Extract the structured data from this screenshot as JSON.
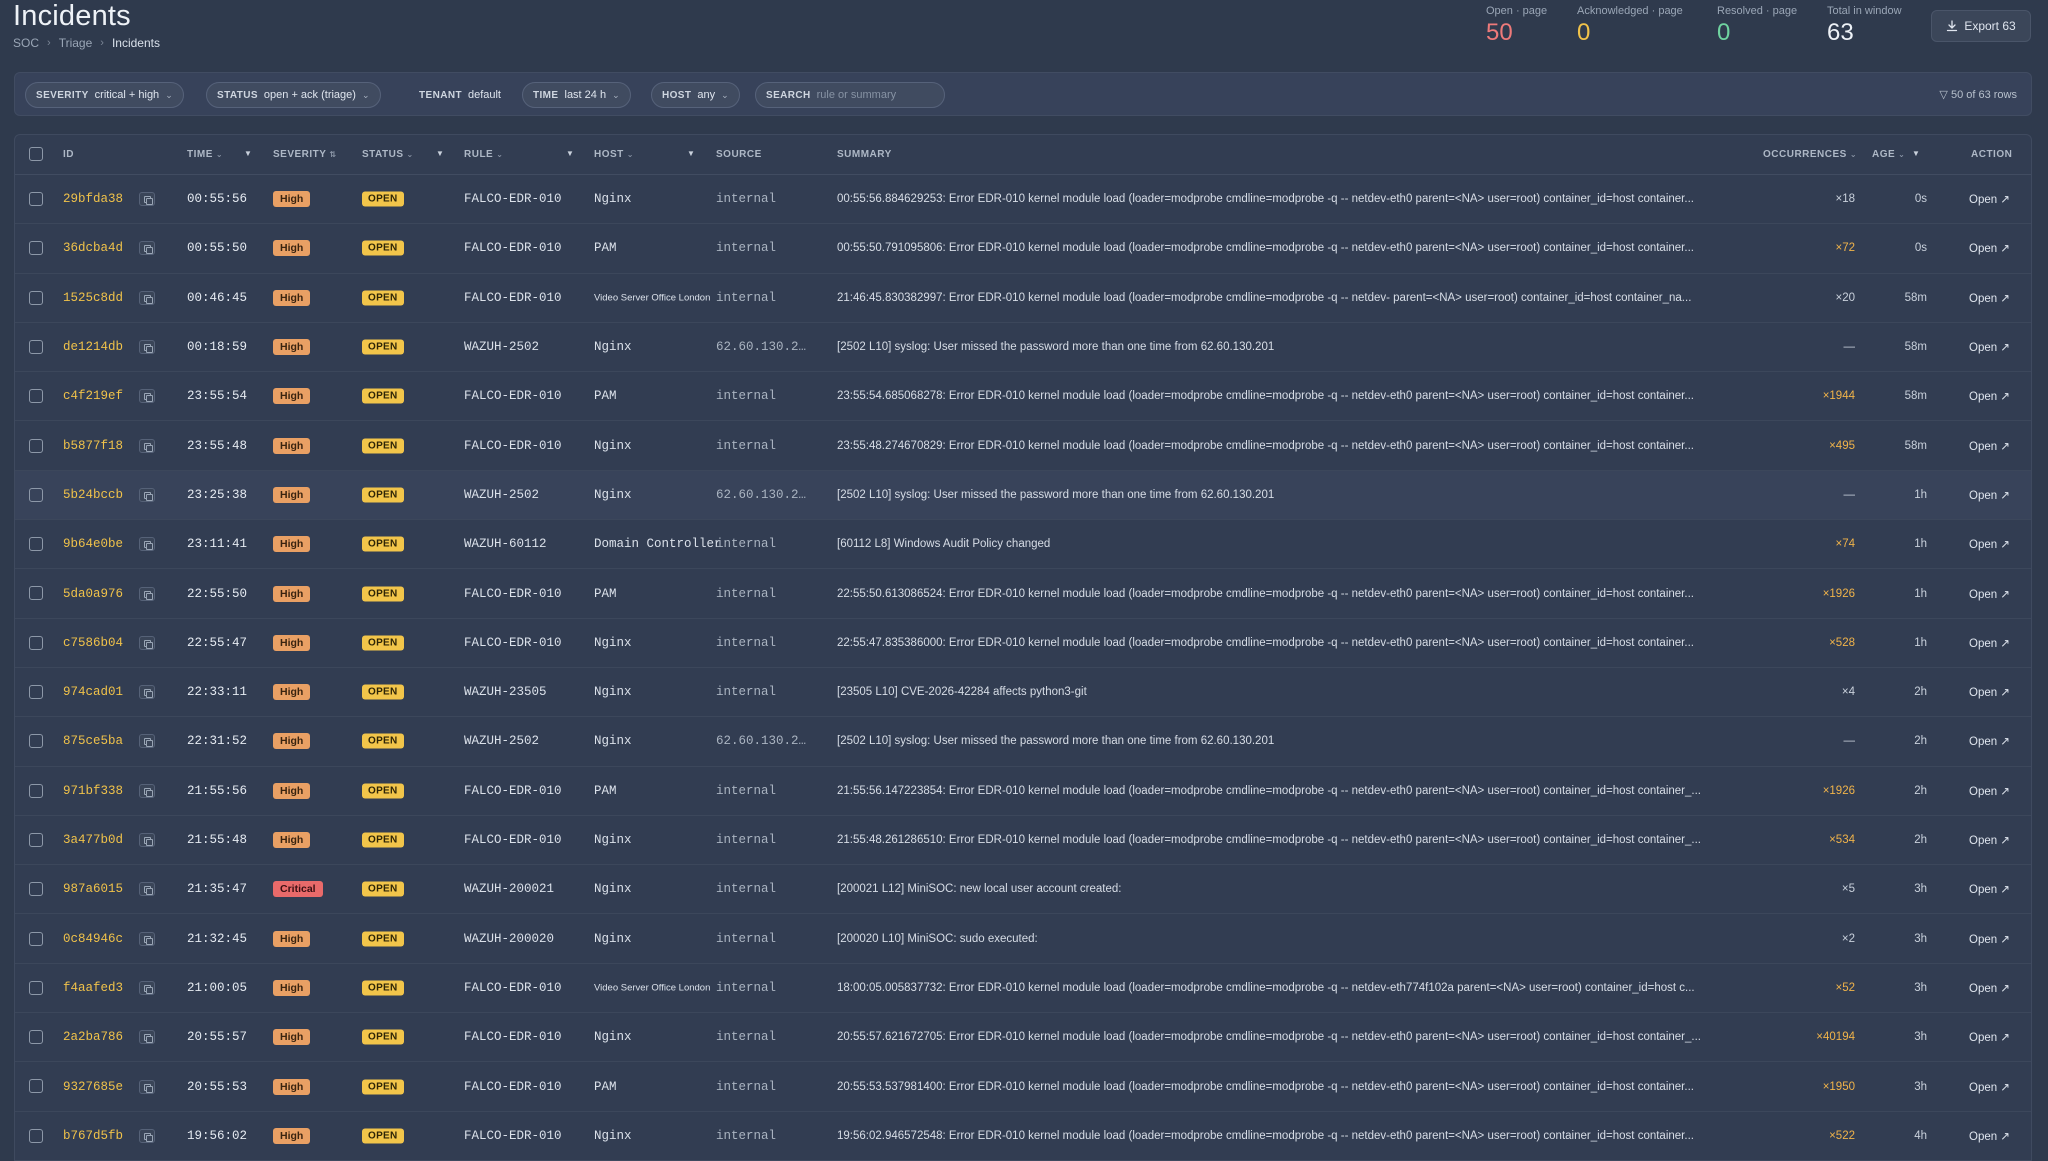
{
  "header": {
    "title": "Incidents",
    "breadcrumb": [
      "SOC",
      "Triage",
      "Incidents"
    ],
    "stats": [
      {
        "label": "Open · page",
        "value": "50",
        "color": "#ee7a7a"
      },
      {
        "label": "Acknowledged · page",
        "value": "0",
        "color": "#f0c24a"
      },
      {
        "label": "Resolved · page",
        "value": "0",
        "color": "#6fd3a0"
      },
      {
        "label": "Total in window",
        "value": "63",
        "color": "#eef2f7"
      }
    ],
    "export_label": "Export 63"
  },
  "filters": {
    "severity": {
      "key": "SEVERITY",
      "value": "critical + high"
    },
    "status": {
      "key": "STATUS",
      "value": "open + ack (triage)"
    },
    "tenant": {
      "key": "TENANT",
      "value": "default"
    },
    "time": {
      "key": "TIME",
      "value": "last 24 h"
    },
    "host": {
      "key": "HOST",
      "value": "any"
    },
    "search": {
      "key": "SEARCH",
      "placeholder": "rule or summary"
    },
    "row_count": "50 of 63 rows"
  },
  "table": {
    "columns": {
      "id": "ID",
      "time": "TIME",
      "severity": "SEVERITY",
      "status": "STATUS",
      "rule": "RULE",
      "host": "HOST",
      "source": "SOURCE",
      "summary": "SUMMARY",
      "occurrences": "OCCURRENCES",
      "age": "AGE",
      "action": "ACTION"
    },
    "action_label": "Open ↗",
    "rows": [
      {
        "id": "29bfda38",
        "time": "00:55:56",
        "severity": "High",
        "status": "OPEN",
        "rule": "FALCO-EDR-010",
        "host": "Nginx",
        "source": "internal",
        "summary": "00:55:56.884629253: Error EDR-010 kernel module load (loader=modprobe cmdline=modprobe -q -- netdev-eth0 parent=<NA> user=root) container_id=host container...",
        "occurrences": "×18",
        "age": "0s"
      },
      {
        "id": "36dcba4d",
        "time": "00:55:50",
        "severity": "High",
        "status": "OPEN",
        "rule": "FALCO-EDR-010",
        "host": "PAM",
        "source": "internal",
        "summary": "00:55:50.791095806: Error EDR-010 kernel module load (loader=modprobe cmdline=modprobe -q -- netdev-eth0 parent=<NA> user=root) container_id=host container...",
        "occurrences": "×72",
        "age": "0s"
      },
      {
        "id": "1525c8dd",
        "time": "00:46:45",
        "severity": "High",
        "status": "OPEN",
        "rule": "FALCO-EDR-010",
        "host": "Video Server Office London",
        "source": "internal",
        "summary": "21:46:45.830382997: Error EDR-010 kernel module load (loader=modprobe cmdline=modprobe -q -- netdev- parent=<NA> user=root) container_id=host container_na...",
        "occurrences": "×20",
        "age": "58m"
      },
      {
        "id": "de1214db",
        "time": "00:18:59",
        "severity": "High",
        "status": "OPEN",
        "rule": "WAZUH-2502",
        "host": "Nginx",
        "source": "62.60.130.2…",
        "summary": "[2502 L10] syslog: User missed the password more than one time from 62.60.130.201",
        "occurrences": "—",
        "age": "58m"
      },
      {
        "id": "c4f219ef",
        "time": "23:55:54",
        "severity": "High",
        "status": "OPEN",
        "rule": "FALCO-EDR-010",
        "host": "PAM",
        "source": "internal",
        "summary": "23:55:54.685068278: Error EDR-010 kernel module load (loader=modprobe cmdline=modprobe -q -- netdev-eth0 parent=<NA> user=root) container_id=host container...",
        "occurrences": "×1944",
        "age": "58m"
      },
      {
        "id": "b5877f18",
        "time": "23:55:48",
        "severity": "High",
        "status": "OPEN",
        "rule": "FALCO-EDR-010",
        "host": "Nginx",
        "source": "internal",
        "summary": "23:55:48.274670829: Error EDR-010 kernel module load (loader=modprobe cmdline=modprobe -q -- netdev-eth0 parent=<NA> user=root) container_id=host container...",
        "occurrences": "×495",
        "age": "58m"
      },
      {
        "id": "5b24bccb",
        "time": "23:25:38",
        "severity": "High",
        "status": "OPEN",
        "rule": "WAZUH-2502",
        "host": "Nginx",
        "source": "62.60.130.2…",
        "summary": "[2502 L10] syslog: User missed the password more than one time from 62.60.130.201",
        "occurrences": "—",
        "age": "1h"
      },
      {
        "id": "9b64e0be",
        "time": "23:11:41",
        "severity": "High",
        "status": "OPEN",
        "rule": "WAZUH-60112",
        "host": "Domain Controller",
        "source": "internal",
        "summary": "[60112 L8] Windows Audit Policy changed",
        "occurrences": "×74",
        "age": "1h"
      },
      {
        "id": "5da0a976",
        "time": "22:55:50",
        "severity": "High",
        "status": "OPEN",
        "rule": "FALCO-EDR-010",
        "host": "PAM",
        "source": "internal",
        "summary": "22:55:50.613086524: Error EDR-010 kernel module load (loader=modprobe cmdline=modprobe -q -- netdev-eth0 parent=<NA> user=root) container_id=host container...",
        "occurrences": "×1926",
        "age": "1h"
      },
      {
        "id": "c7586b04",
        "time": "22:55:47",
        "severity": "High",
        "status": "OPEN",
        "rule": "FALCO-EDR-010",
        "host": "Nginx",
        "source": "internal",
        "summary": "22:55:47.835386000: Error EDR-010 kernel module load (loader=modprobe cmdline=modprobe -q -- netdev-eth0 parent=<NA> user=root) container_id=host container...",
        "occurrences": "×528",
        "age": "1h"
      },
      {
        "id": "974cad01",
        "time": "22:33:11",
        "severity": "High",
        "status": "OPEN",
        "rule": "WAZUH-23505",
        "host": "Nginx",
        "source": "internal",
        "summary": "[23505 L10] CVE-2026-42284 affects python3-git",
        "occurrences": "×4",
        "age": "2h"
      },
      {
        "id": "875ce5ba",
        "time": "22:31:52",
        "severity": "High",
        "status": "OPEN",
        "rule": "WAZUH-2502",
        "host": "Nginx",
        "source": "62.60.130.2…",
        "summary": "[2502 L10] syslog: User missed the password more than one time from 62.60.130.201",
        "occurrences": "—",
        "age": "2h"
      },
      {
        "id": "971bf338",
        "time": "21:55:56",
        "severity": "High",
        "status": "OPEN",
        "rule": "FALCO-EDR-010",
        "host": "PAM",
        "source": "internal",
        "summary": "21:55:56.147223854: Error EDR-010 kernel module load (loader=modprobe cmdline=modprobe -q -- netdev-eth0 parent=<NA> user=root) container_id=host container_...",
        "occurrences": "×1926",
        "age": "2h"
      },
      {
        "id": "3a477b0d",
        "time": "21:55:48",
        "severity": "High",
        "status": "OPEN",
        "rule": "FALCO-EDR-010",
        "host": "Nginx",
        "source": "internal",
        "summary": "21:55:48.261286510: Error EDR-010 kernel module load (loader=modprobe cmdline=modprobe -q -- netdev-eth0 parent=<NA> user=root) container_id=host container_...",
        "occurrences": "×534",
        "age": "2h"
      },
      {
        "id": "987a6015",
        "time": "21:35:47",
        "severity": "Critical",
        "status": "OPEN",
        "rule": "WAZUH-200021",
        "host": "Nginx",
        "source": "internal",
        "summary": "[200021 L12] MiniSOC: new local user account created:",
        "occurrences": "×5",
        "age": "3h"
      },
      {
        "id": "0c84946c",
        "time": "21:32:45",
        "severity": "High",
        "status": "OPEN",
        "rule": "WAZUH-200020",
        "host": "Nginx",
        "source": "internal",
        "summary": "[200020 L10] MiniSOC: sudo executed:",
        "occurrences": "×2",
        "age": "3h"
      },
      {
        "id": "f4aafed3",
        "time": "21:00:05",
        "severity": "High",
        "status": "OPEN",
        "rule": "FALCO-EDR-010",
        "host": "Video Server Office London",
        "source": "internal",
        "summary": "18:00:05.005837732: Error EDR-010 kernel module load (loader=modprobe cmdline=modprobe -q -- netdev-eth774f102a parent=<NA> user=root) container_id=host c...",
        "occurrences": "×52",
        "age": "3h"
      },
      {
        "id": "2a2ba786",
        "time": "20:55:57",
        "severity": "High",
        "status": "OPEN",
        "rule": "FALCO-EDR-010",
        "host": "Nginx",
        "source": "internal",
        "summary": "20:55:57.621672705: Error EDR-010 kernel module load (loader=modprobe cmdline=modprobe -q -- netdev-eth0 parent=<NA> user=root) container_id=host container_...",
        "occurrences": "×40194",
        "age": "3h"
      },
      {
        "id": "9327685e",
        "time": "20:55:53",
        "severity": "High",
        "status": "OPEN",
        "rule": "FALCO-EDR-010",
        "host": "PAM",
        "source": "internal",
        "summary": "20:55:53.537981400: Error EDR-010 kernel module load (loader=modprobe cmdline=modprobe -q -- netdev-eth0 parent=<NA> user=root) container_id=host container...",
        "occurrences": "×1950",
        "age": "3h"
      },
      {
        "id": "b767d5fb",
        "time": "19:56:02",
        "severity": "High",
        "status": "OPEN",
        "rule": "FALCO-EDR-010",
        "host": "Nginx",
        "source": "internal",
        "summary": "19:56:02.946572548: Error EDR-010 kernel module load (loader=modprobe cmdline=modprobe -q -- netdev-eth0 parent=<NA> user=root) container_id=host container...",
        "occurrences": "×522",
        "age": "4h"
      }
    ]
  }
}
